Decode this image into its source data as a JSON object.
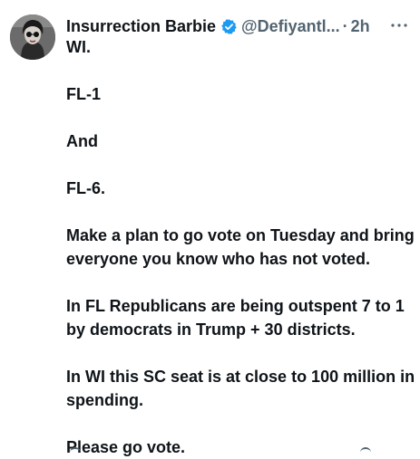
{
  "tweet": {
    "display_name": "Insurrection Barbie",
    "handle": "@Defiyantl...",
    "separator": "·",
    "time": "2h",
    "more_label": "···",
    "paragraphs": [
      "WI.",
      "FL-1",
      "And",
      "FL-6.",
      "Make a plan to go vote on Tuesday and bring everyone you know who has not voted.",
      "In FL Republicans are being outspent 7 to 1 by democrats in Trump + 30 districts.",
      "In WI this SC seat is at close to 100 million in spending.",
      "Please go vote."
    ]
  },
  "colors": {
    "text": "#0f1419",
    "secondary": "#536471",
    "verified_badge": "#1d9bf0",
    "background": "#ffffff"
  },
  "icons": {
    "verified": "verified-badge-icon",
    "more": "more-options-icon"
  }
}
